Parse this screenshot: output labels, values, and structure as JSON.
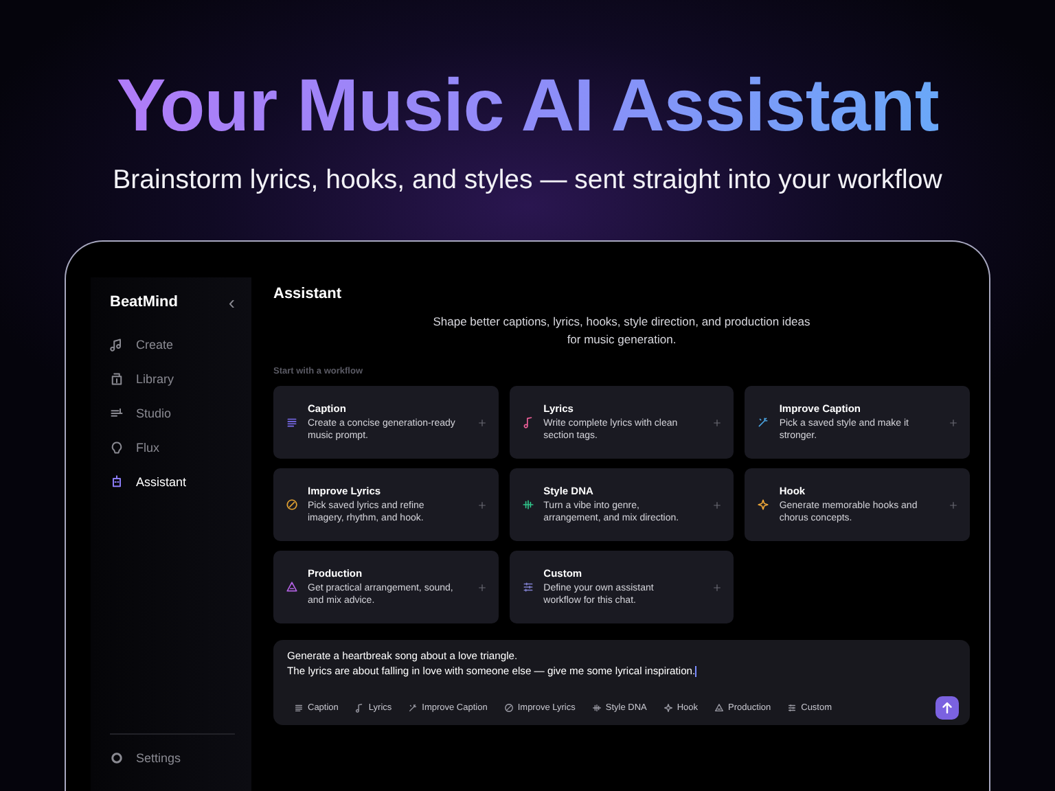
{
  "hero": {
    "title": "Your Music AI Assistant",
    "subtitle": "Brainstorm lyrics, hooks, and styles — sent straight into your workflow"
  },
  "sidebar": {
    "brand": "BeatMind",
    "collapse_icon": "‹",
    "items": [
      {
        "label": "Create",
        "kind": "create",
        "selected": false
      },
      {
        "label": "Library",
        "kind": "library",
        "selected": false
      },
      {
        "label": "Studio",
        "kind": "studio",
        "selected": false
      },
      {
        "label": "Flux",
        "kind": "flux",
        "selected": false
      },
      {
        "label": "Assistant",
        "kind": "assistant",
        "selected": true
      }
    ],
    "settings": "Settings"
  },
  "main": {
    "title": "Assistant",
    "intro": "Shape better captions, lyrics, hooks, style direction, and production ideas for music generation.",
    "section_label": "Start with a workflow",
    "workflows": [
      {
        "title": "Caption",
        "description": "Create a concise generation-ready music prompt.",
        "kind": "caption",
        "color": "#7b6cf0"
      },
      {
        "title": "Lyrics",
        "description": "Write complete lyrics with clean section tags.",
        "kind": "lyrics",
        "color": "#f0609a"
      },
      {
        "title": "Improve Caption",
        "description": "Pick a saved style and make it stronger.",
        "kind": "improve_caption",
        "color": "#4aa3e0"
      },
      {
        "title": "Improve Lyrics",
        "description": "Pick saved lyrics and refine imagery, rhythm, and hook.",
        "kind": "improve_lyrics",
        "color": "#e0a030"
      },
      {
        "title": "Style DNA",
        "description": "Turn a vibe into genre, arrangement, and mix direction.",
        "kind": "style_dna",
        "color": "#30c48a"
      },
      {
        "title": "Hook",
        "description": "Generate memorable hooks and chorus concepts.",
        "kind": "hook",
        "color": "#f0a838"
      },
      {
        "title": "Production",
        "description": "Get practical arrangement, sound, and mix advice.",
        "kind": "production",
        "color": "#b060e0"
      },
      {
        "title": "Custom",
        "description": "Define your own assistant workflow for this chat.",
        "kind": "custom",
        "color": "#8080d0"
      }
    ],
    "composer": {
      "value": "Generate a heartbreak song about a love triangle.\nThe lyrics are about falling in love with someone else — give me some lyrical inspiration.",
      "chips": [
        {
          "label": "Caption",
          "kind": "caption"
        },
        {
          "label": "Lyrics",
          "kind": "lyrics"
        },
        {
          "label": "Improve Caption",
          "kind": "improve_caption"
        },
        {
          "label": "Improve Lyrics",
          "kind": "improve_lyrics"
        },
        {
          "label": "Style DNA",
          "kind": "style_dna"
        },
        {
          "label": "Hook",
          "kind": "hook"
        },
        {
          "label": "Production",
          "kind": "production"
        },
        {
          "label": "Custom",
          "kind": "custom"
        }
      ]
    }
  }
}
